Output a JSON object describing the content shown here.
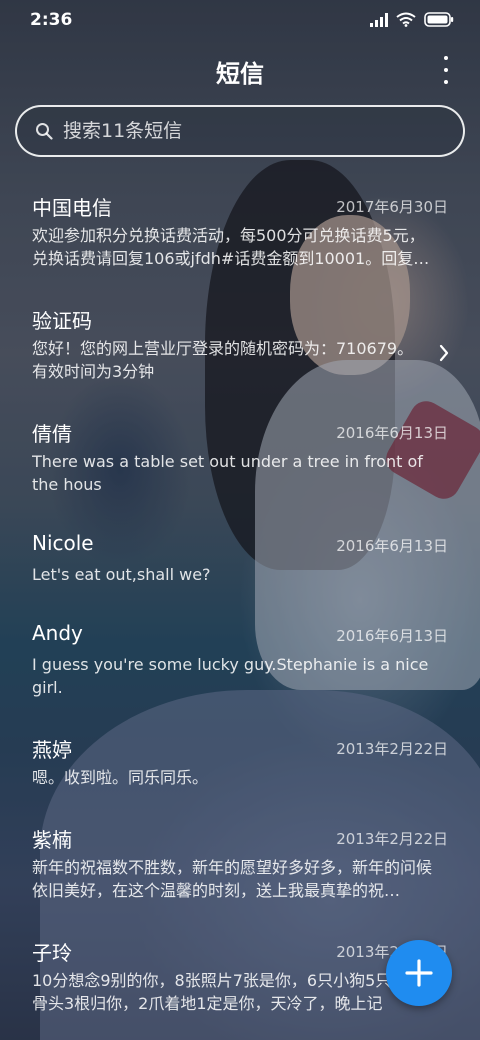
{
  "status_bar": {
    "time": "2:36",
    "icons": [
      "signal-icon",
      "wifi-icon",
      "battery-icon"
    ]
  },
  "header": {
    "title": "短信",
    "more_icon": "more-vertical-icon"
  },
  "search": {
    "placeholder": "搜索11条短信",
    "icon": "search-icon"
  },
  "messages": [
    {
      "sender": "中国电信",
      "date": "2017年6月30日",
      "preview": "欢迎参加积分兑换话费活动，每500分可兑换话费5元，兑换话费请回复106或jfdh#话费金额到10001。回复…"
    },
    {
      "sender": "验证码",
      "date": "",
      "preview": "您好！您的网上营业厅登录的随机密码为：710679。有效时间为3分钟",
      "has_chevron": true
    },
    {
      "sender": "倩倩",
      "date": "2016年6月13日",
      "preview": "There was a table set out under a tree in front of the hous"
    },
    {
      "sender": "Nicole",
      "date": "2016年6月13日",
      "preview": "Let's eat out,shall we?"
    },
    {
      "sender": "Andy",
      "date": "2016年6月13日",
      "preview": "I guess you're some lucky guy.Stephanie is a nice girl."
    },
    {
      "sender": "燕婷",
      "date": "2013年2月22日",
      "preview": "嗯。收到啦。同乐同乐。"
    },
    {
      "sender": "紫楠",
      "date": "2013年2月22日",
      "preview": "新年的祝福数不胜数，新年的愿望好多好多，新年的问候依旧美好，在这个温馨的时刻，送上我最真挚的祝…"
    },
    {
      "sender": "子玲",
      "date": "2013年2月22日",
      "preview": "10分想念9别的你，8张照片7张是你，6只小狗5只，4根骨头3根归你，2爪着地1定是你，天冷了，晚上记"
    }
  ],
  "fab": {
    "icon": "plus-icon"
  },
  "colors": {
    "accent": "#1f8cf0",
    "text_primary": "#ffffff"
  }
}
